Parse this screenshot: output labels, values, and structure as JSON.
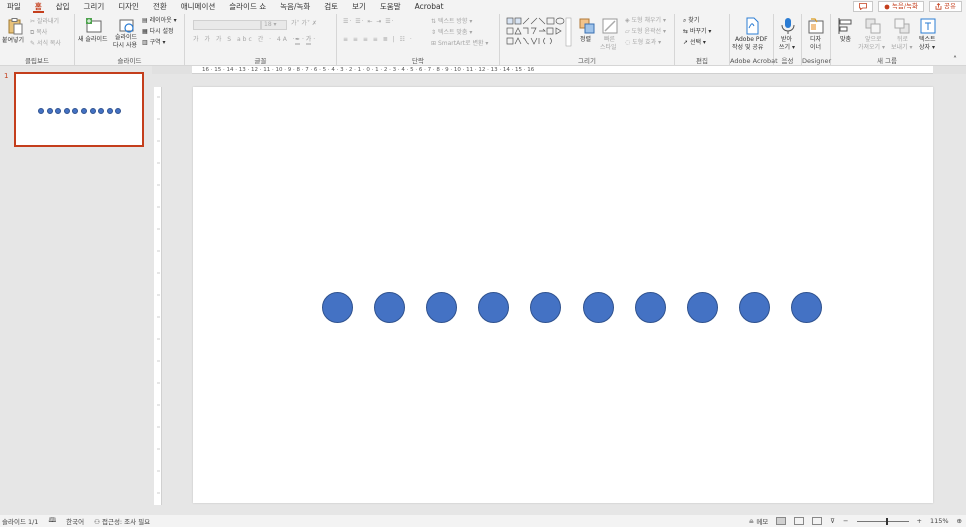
{
  "tabs": [
    "파일",
    "홈",
    "삽입",
    "그리기",
    "디자인",
    "전환",
    "애니메이션",
    "슬라이드 쇼",
    "녹음/녹화",
    "검토",
    "보기",
    "도움말",
    "Acrobat"
  ],
  "active_tab_index": 1,
  "tabbar_right": {
    "comment_icon": "comment-icon",
    "record_label": "녹음/녹화",
    "share_label": "공유"
  },
  "ribbon": {
    "clipboard": {
      "paste": "붙여넣기",
      "cut": "잘라내기",
      "copy": "복사",
      "format_painter": "서식 복사",
      "label": "클립보드"
    },
    "slides": {
      "new_slide": "새 슬라이드",
      "reuse_slide_line1": "슬라이드",
      "reuse_slide_line2": "다시 사용",
      "layout": "레이아웃",
      "reset": "다시 설정",
      "section": "구역",
      "label": "슬라이드"
    },
    "font": {
      "font_size": "18",
      "label": "글꼴"
    },
    "paragraph": {
      "text_direction": "텍스트 방향",
      "align_text": "텍스트 맞춤",
      "smartart": "SmartArt로 변환",
      "label": "단락"
    },
    "drawing": {
      "arrange": "정렬",
      "quick_styles_line1": "빠른",
      "quick_styles_line2": "스타일",
      "shape_fill": "도형 채우기",
      "shape_outline": "도형 윤곽선",
      "shape_effects": "도형 효과",
      "label": "그리기"
    },
    "editing": {
      "find": "찾기",
      "replace": "바꾸기",
      "select": "선택",
      "label": "편집"
    },
    "acrobat": {
      "line1": "Adobe PDF",
      "line2": "작성 및 공유",
      "label": "Adobe Acrobat"
    },
    "voice": {
      "line1": "받아",
      "line2": "쓰기",
      "label": "음성"
    },
    "designer": {
      "line1": "디자",
      "line2": "이너",
      "label": "Designer"
    },
    "new_group": {
      "align": "맞춤",
      "bring_forward_line1": "앞으로",
      "bring_forward_line2": "가져오기",
      "send_backward_line1": "뒤로",
      "send_backward_line2": "보내기",
      "textbox_line1": "텍스트",
      "textbox_line2": "상자",
      "label": "새 그룹"
    }
  },
  "ruler_text": "16 · 15 · 14 · 13 · 12 · 11 · 10 · 9 · 8 · 7 · 6 · 5 · 4 · 3 · 2 · 1 · 0 · 1 · 2 · 3 · 4 · 5 · 6 · 7 · 8 · 9 · 10 · 11 · 12 · 13 · 14 · 15 · 16",
  "slide_number": "1",
  "circle_count": 10,
  "circle_color": "#4472c4",
  "accent_color": "#c43e1c",
  "statusbar": {
    "slide_info": "슬라이드 1/1",
    "language": "한국어",
    "accessibility": "접근성: 조사 필요",
    "notes": "메모",
    "zoom": "115%"
  }
}
